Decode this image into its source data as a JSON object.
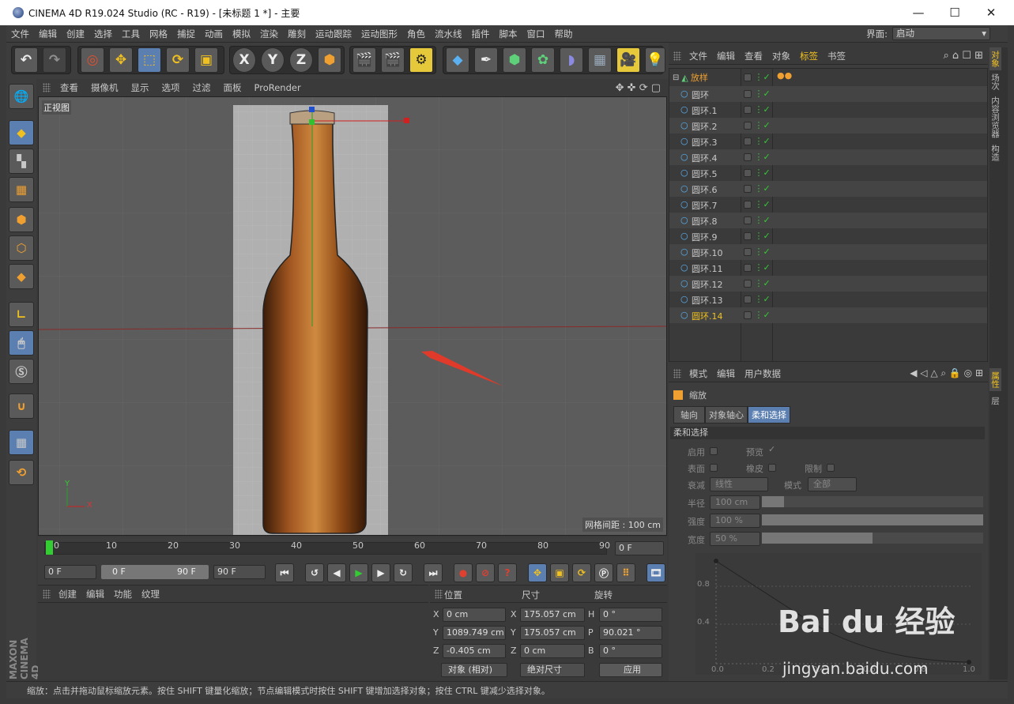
{
  "window": {
    "title": "CINEMA 4D R19.024 Studio (RC - R19) - [未标题 1 *] - 主要",
    "minimize": "—",
    "maximize": "☐",
    "close": "✕"
  },
  "menu": [
    "文件",
    "编辑",
    "创建",
    "选择",
    "工具",
    "网格",
    "捕捉",
    "动画",
    "模拟",
    "渲染",
    "雕刻",
    "运动跟踪",
    "运动图形",
    "角色",
    "流水线",
    "插件",
    "脚本",
    "窗口",
    "帮助"
  ],
  "layout": {
    "label": "界面:",
    "value": "启动"
  },
  "viewport": {
    "menu": [
      "查看",
      "摄像机",
      "显示",
      "选项",
      "过滤",
      "面板",
      "ProRender"
    ],
    "view_name": "正视图",
    "grid_spacing": "网格间距 : 100 cm",
    "axis_x": "X",
    "axis_y": "Y"
  },
  "timeline": {
    "ticks": [
      "0",
      "10",
      "20",
      "30",
      "40",
      "50",
      "60",
      "70",
      "80",
      "90"
    ],
    "current": "0 F"
  },
  "playbar": {
    "start": "0 F",
    "range_start": "0 F",
    "range_end": "90 F",
    "end": "90 F"
  },
  "material": {
    "menu": [
      "创建",
      "编辑",
      "功能",
      "纹理"
    ]
  },
  "coords": {
    "headers": [
      "位置",
      "尺寸",
      "旋转"
    ],
    "rows": [
      {
        "axis": "X",
        "pos": "0 cm",
        "size_axis": "X",
        "size": "175.057 cm",
        "rot_axis": "H",
        "rot": "0 °"
      },
      {
        "axis": "Y",
        "pos": "1089.749 cm",
        "size_axis": "Y",
        "size": "175.057 cm",
        "rot_axis": "P",
        "rot": "90.021 °"
      },
      {
        "axis": "Z",
        "pos": "-0.405 cm",
        "size_axis": "Z",
        "size": "0 cm",
        "rot_axis": "B",
        "rot": "0 °"
      }
    ],
    "mode1": "对象 (相对)",
    "mode2": "绝对尺寸",
    "apply": "应用"
  },
  "objects": {
    "menu": [
      "文件",
      "编辑",
      "查看",
      "对象",
      "标签",
      "书签"
    ],
    "root": "放样",
    "children": [
      "圆环",
      "圆环.1",
      "圆环.2",
      "圆环.3",
      "圆环.4",
      "圆环.5",
      "圆环.6",
      "圆环.7",
      "圆环.8",
      "圆环.9",
      "圆环.10",
      "圆环.11",
      "圆环.12",
      "圆环.13",
      "圆环.14"
    ]
  },
  "attributes": {
    "menu": [
      "模式",
      "编辑",
      "用户数据"
    ],
    "tool": "缩放",
    "tabs": [
      "轴向",
      "对象轴心",
      "柔和选择"
    ],
    "section": "柔和选择",
    "enable": "启用",
    "preview": "预览",
    "surface": "表面",
    "rubber": "橡皮",
    "limit": "限制",
    "falloff_label": "衰减",
    "falloff": "线性",
    "mode_label": "模式",
    "mode": "全部",
    "radius_label": "半径",
    "radius": "100 cm",
    "strength_label": "强度",
    "strength": "100 %",
    "width_label": "宽度",
    "width": "50 %",
    "graph_y": [
      "0.8",
      "0.4"
    ],
    "graph_x": [
      "0.0",
      "0.2",
      "0.4",
      "0.6",
      "0.8",
      "1.0"
    ]
  },
  "right_tabs": [
    "对象",
    "场次",
    "内容浏览器",
    "构造"
  ],
  "right_tabs2": [
    "属性",
    "层"
  ],
  "status": "缩放：点击并拖动鼠标缩放元素。按住 SHIFT 键量化缩放；节点编辑模式时按住 SHIFT 键增加选择对象；按住 CTRL 键减少选择对象。",
  "watermark": {
    "brand": "Bai du 经验",
    "url": "jingyan.baidu.com"
  },
  "colors": {
    "accent": "#f0c020",
    "selected_blue": "#5b7fb0"
  }
}
